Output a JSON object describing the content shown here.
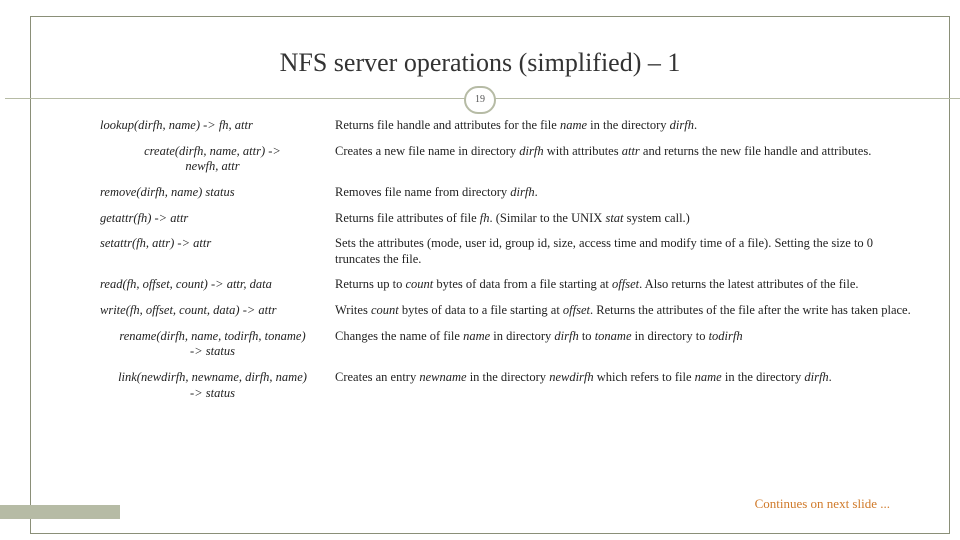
{
  "title": "NFS server operations (simplified) – 1",
  "slideNumber": "19",
  "rows": [
    {
      "op": "lookup(dirfh, name) -> fh, attr",
      "desc": "Returns file handle and attributes for the file <em>name</em> in the directory <em>dirfh</em>."
    },
    {
      "op": "create(dirfh, name, attr) -><br>newfh, attr",
      "opCenter": true,
      "desc": "Creates a new file name in directory <em>dirfh</em> with attributes <em>attr</em> and returns the new file handle and attributes."
    },
    {
      "op": "remove(dirfh, name)  status",
      "desc": "Removes file name from directory <em>dirfh</em>."
    },
    {
      "op": "getattr(fh) -> attr",
      "desc": "Returns file attributes of file <em>fh</em>. (Similar to the UNIX <em>stat</em> system call.)"
    },
    {
      "op": "setattr(fh, attr) -> attr",
      "desc": "Sets the attributes (mode, user id, group id, size, access time and modify time of a file). Setting the size to 0 truncates the file."
    },
    {
      "op": "read(fh, offset, count) -> attr, data",
      "desc": "Returns up to <em>count</em> bytes of data from a file starting at <em>offset</em>. Also returns the latest attributes of the file."
    },
    {
      "op": "write(fh, offset, count, data) -> attr",
      "desc": "Writes <em>count</em> bytes of data to a file starting at <em>offset</em>. Returns the attributes of the file after the write has taken place."
    },
    {
      "op": "rename(dirfh, name, todirfh, toname)<br>-> status",
      "opCenter": true,
      "desc": "Changes the name of file <em>name</em> in directory <em>dirfh</em> to <em>toname</em> in directory to <em>todirfh</em>"
    },
    {
      "op": "link(newdirfh, newname, dirfh, name)<br>-> status",
      "opCenter": true,
      "desc": "Creates an entry <em>newname</em> in the directory <em>newdirfh</em> which refers to file <em>name</em> in the directory <em>dirfh</em>."
    }
  ],
  "footer": "Continues on next slide ..."
}
